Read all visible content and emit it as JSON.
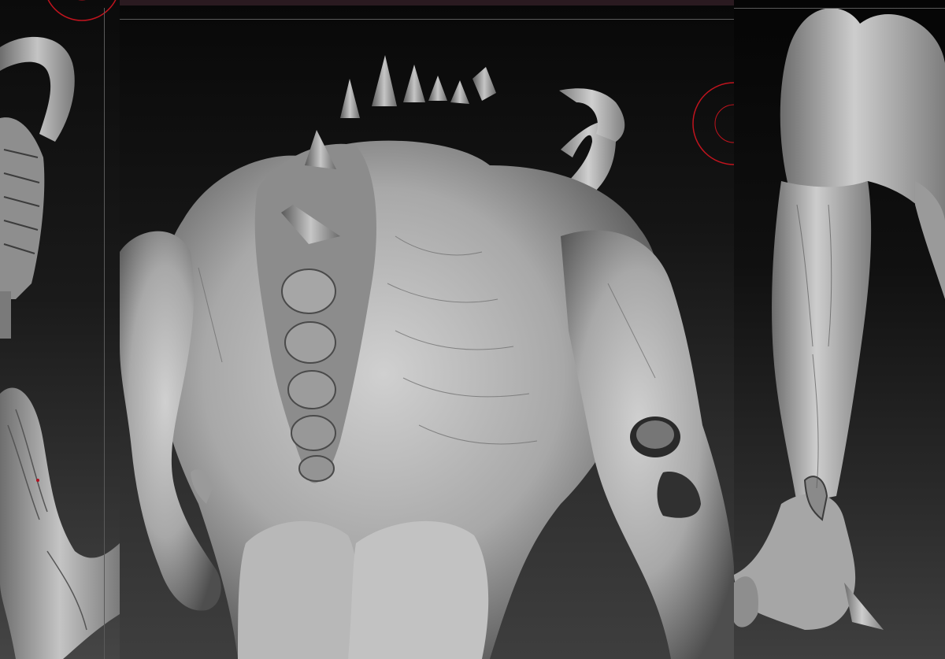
{
  "window": {
    "panels": [
      "back-view-left",
      "back-view-center",
      "legs-view-right"
    ]
  },
  "colors": {
    "background_top": "#080808",
    "background_bottom": "#3e3e3e",
    "sculpt_clay": "#b4b4b4",
    "sculpt_shadow": "#3a3a3a",
    "brush_ring": "#c0141e",
    "frame_line": "#5a5a5a",
    "top_strip": "#2a1a20"
  },
  "icons": {
    "brush_cursor": "brush-ring-icon",
    "brush_cursor_small": "brush-ring-small-icon"
  }
}
